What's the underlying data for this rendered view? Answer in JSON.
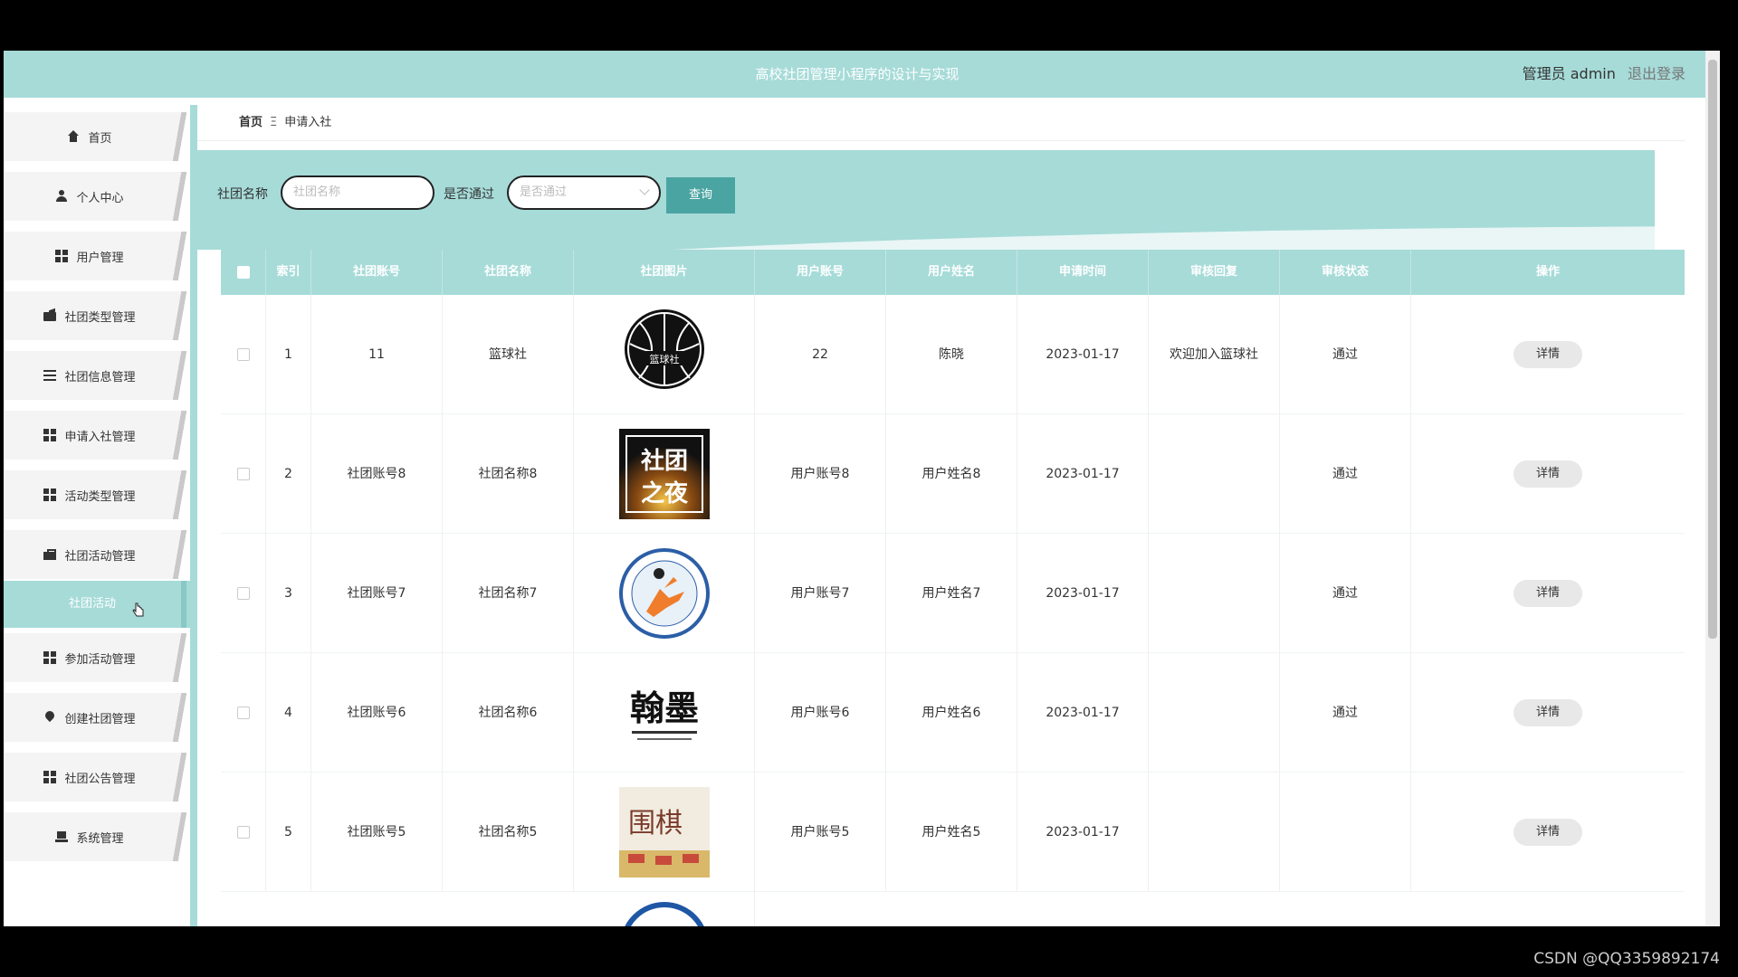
{
  "app": {
    "title": "高校社团管理小程序的设计与实现",
    "user_label": "管理员 admin",
    "logout_label": "退出登录"
  },
  "sidebar": {
    "items": [
      {
        "label": "首页",
        "icon": "home-icon"
      },
      {
        "label": "个人中心",
        "icon": "user-icon"
      },
      {
        "label": "用户管理",
        "icon": "grid-icon"
      },
      {
        "label": "社团类型管理",
        "icon": "wallet-icon"
      },
      {
        "label": "社团信息管理",
        "icon": "list-icon"
      },
      {
        "label": "申请入社管理",
        "icon": "grid-icon"
      },
      {
        "label": "活动类型管理",
        "icon": "grid-icon"
      },
      {
        "label": "社团活动管理",
        "icon": "briefcase-icon"
      },
      {
        "label": "参加活动管理",
        "icon": "grid-icon"
      },
      {
        "label": "创建社团管理",
        "icon": "pin-icon"
      },
      {
        "label": "社团公告管理",
        "icon": "grid-icon"
      },
      {
        "label": "系统管理",
        "icon": "laptop-icon"
      }
    ],
    "active_sub_item": "社团活动"
  },
  "breadcrumb": {
    "home": "首页",
    "separator": "Ξ",
    "current": "申请入社"
  },
  "search": {
    "club_name_label": "社团名称",
    "club_name_placeholder": "社团名称",
    "passed_label": "是否通过",
    "passed_placeholder": "是否通过",
    "query_button": "查询"
  },
  "table": {
    "columns": [
      "索引",
      "社团账号",
      "社团名称",
      "社团图片",
      "用户账号",
      "用户姓名",
      "申请时间",
      "审核回复",
      "审核状态",
      "操作"
    ],
    "rows": [
      {
        "index": "1",
        "club_account": "11",
        "club_name": "篮球社",
        "image": "basketball-club-logo",
        "user_account": "22",
        "user_name": "陈晓",
        "apply_time": "2023-01-17",
        "reply": "欢迎加入篮球社",
        "status": "通过",
        "action": "详情"
      },
      {
        "index": "2",
        "club_account": "社团账号8",
        "club_name": "社团名称8",
        "image": "club-night-poster",
        "user_account": "用户账号8",
        "user_name": "用户姓名8",
        "apply_time": "2023-01-17",
        "reply": "",
        "status": "通过",
        "action": "详情"
      },
      {
        "index": "3",
        "club_account": "社团账号7",
        "club_name": "社团名称7",
        "image": "football-club-badge",
        "user_account": "用户账号7",
        "user_name": "用户姓名7",
        "apply_time": "2023-01-17",
        "reply": "",
        "status": "通过",
        "action": "详情"
      },
      {
        "index": "4",
        "club_account": "社团账号6",
        "club_name": "社团名称6",
        "image": "calligraphy-club-logo",
        "user_account": "用户账号6",
        "user_name": "用户姓名6",
        "apply_time": "2023-01-17",
        "reply": "",
        "status": "通过",
        "action": "详情"
      },
      {
        "index": "5",
        "club_account": "社团账号5",
        "club_name": "社团名称5",
        "image": "go-club-photo",
        "user_account": "用户账号5",
        "user_name": "用户姓名5",
        "apply_time": "2023-01-17",
        "reply": "",
        "status": "",
        "action": "详情"
      }
    ]
  },
  "logo_text": {
    "basketball": "篮球社",
    "night_line1": "社团",
    "night_line2": "之夜",
    "calligraphy": "翰墨",
    "go": "围棋"
  },
  "watermark": "CSDN @QQ3359892174",
  "colors": {
    "accent": "#a6dbd8",
    "button": "#4aa4a2"
  }
}
